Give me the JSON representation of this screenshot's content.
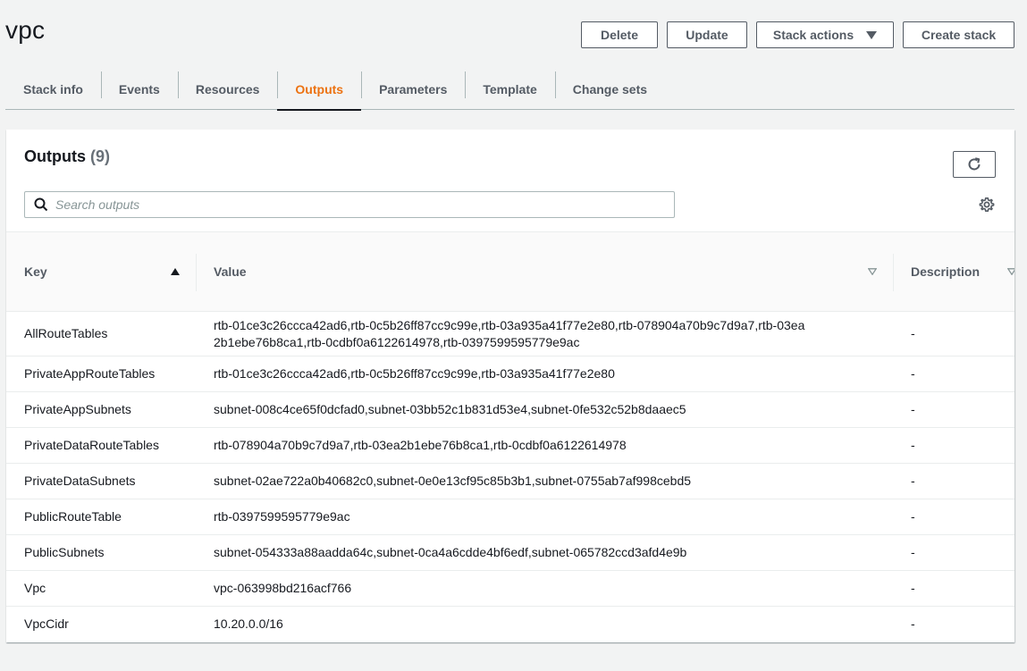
{
  "page": {
    "title": "vpc"
  },
  "actions": {
    "delete": "Delete",
    "update": "Update",
    "stack_actions": "Stack actions",
    "create": "Create stack"
  },
  "tabs": [
    {
      "label": "Stack info"
    },
    {
      "label": "Events"
    },
    {
      "label": "Resources"
    },
    {
      "label": "Outputs",
      "active": true
    },
    {
      "label": "Parameters"
    },
    {
      "label": "Template"
    },
    {
      "label": "Change sets"
    }
  ],
  "outputs": {
    "title": "Outputs",
    "count": "(9)",
    "search_placeholder": "Search outputs",
    "columns": {
      "key": "Key",
      "value": "Value",
      "description": "Description"
    },
    "rows": [
      {
        "key": "AllRouteTables",
        "value": "rtb-01ce3c26ccca42ad6,rtb-0c5b26ff87cc9c99e,rtb-03a935a41f77e2e80,rtb-078904a70b9c7d9a7,rtb-03ea2b1ebe76b8ca1,rtb-0cdbf0a6122614978,rtb-0397599595779e9ac",
        "description": "-"
      },
      {
        "key": "PrivateAppRouteTables",
        "value": "rtb-01ce3c26ccca42ad6,rtb-0c5b26ff87cc9c99e,rtb-03a935a41f77e2e80",
        "description": "-"
      },
      {
        "key": "PrivateAppSubnets",
        "value": "subnet-008c4ce65f0dcfad0,subnet-03bb52c1b831d53e4,subnet-0fe532c52b8daaec5",
        "description": "-"
      },
      {
        "key": "PrivateDataRouteTables",
        "value": "rtb-078904a70b9c7d9a7,rtb-03ea2b1ebe76b8ca1,rtb-0cdbf0a6122614978",
        "description": "-"
      },
      {
        "key": "PrivateDataSubnets",
        "value": "subnet-02ae722a0b40682c0,subnet-0e0e13cf95c85b3b1,subnet-0755ab7af998cebd5",
        "description": "-"
      },
      {
        "key": "PublicRouteTable",
        "value": "rtb-0397599595779e9ac",
        "description": "-"
      },
      {
        "key": "PublicSubnets",
        "value": "subnet-054333a88aadda64c,subnet-0ca4a6cdde4bf6edf,subnet-065782ccd3afd4e9b",
        "description": "-"
      },
      {
        "key": "Vpc",
        "value": "vpc-063998bd216acf766",
        "description": "-"
      },
      {
        "key": "VpcCidr",
        "value": "10.20.0.0/16",
        "description": "-"
      }
    ]
  },
  "colors": {
    "accent": "#ec7211",
    "text": "#16191f",
    "muted": "#545b64",
    "background": "#f2f3f3"
  },
  "icons": {
    "refresh": "refresh-icon",
    "search": "search-icon",
    "settings": "gear-icon",
    "sort_asc": "sort-ascending-icon",
    "sort_none": "sort-icon"
  }
}
